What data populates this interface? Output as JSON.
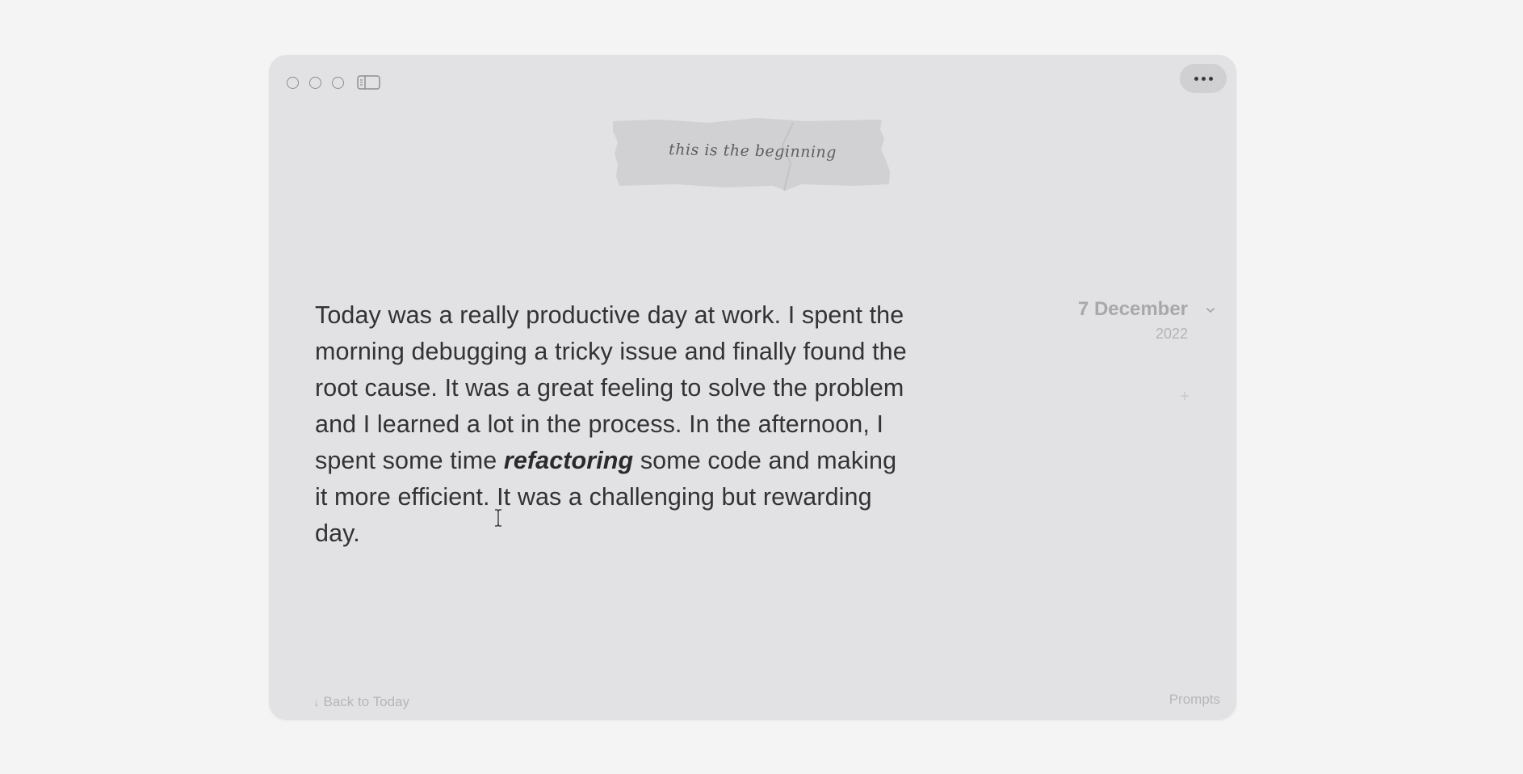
{
  "window": {
    "controls": {
      "close": "window-close",
      "minimize": "window-minimize",
      "zoom": "window-zoom"
    },
    "sidebar_icon": "sidebar-icon",
    "more_icon": "ellipsis-icon"
  },
  "header": {
    "tape_label": "this is the beginning"
  },
  "entry": {
    "text_before": "Today was a really productive day at work. I spent the morning debugging a tricky issue and finally found the root cause. It was a great feeling to solve the problem and I learned a lot in the process. In the afternoon, I spent some time ",
    "text_emphasis": "refactoring",
    "text_after": " some code and making it more efficient. It was a challenging but rewarding day."
  },
  "date": {
    "day_month": "7 December",
    "year": "2022"
  },
  "sidebar_right": {
    "add_label": "+"
  },
  "footer": {
    "back_arrow": "↓",
    "back_label": "Back to Today",
    "prompts_label": "Prompts"
  }
}
